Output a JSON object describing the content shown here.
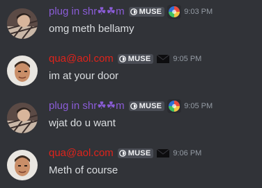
{
  "messages": [
    {
      "username": "plug in shr☘☘m",
      "tag": "MUSE",
      "timestamp": "9:03 PM",
      "text": "omg meth bellamy"
    },
    {
      "username": "qua@aol.com",
      "tag": "MUSE",
      "timestamp": "9:05 PM",
      "text": "im at your door"
    },
    {
      "username": "plug in shr☘☘m",
      "tag": "MUSE",
      "timestamp": "9:05 PM",
      "text": "wjat do u want"
    },
    {
      "username": "qua@aol.com",
      "tag": "MUSE",
      "timestamp": "9:06 PM",
      "text": "Meth of course"
    }
  ],
  "colors": {
    "background": "#313338",
    "username_purple": "#8a5cd6",
    "username_red": "#e0231b",
    "message_text": "#dbdee1",
    "timestamp": "#949ba4",
    "tag_background": "#4a4d55"
  },
  "icons": {
    "tag_icon": "muse-tag-icon",
    "role_icon_purple_user": "colorful-orb-role-icon",
    "role_icon_red_user": "black-envelope-role-icon",
    "avatar_purple_user": "user-avatar-plaid",
    "avatar_red_user": "user-avatar-face"
  }
}
